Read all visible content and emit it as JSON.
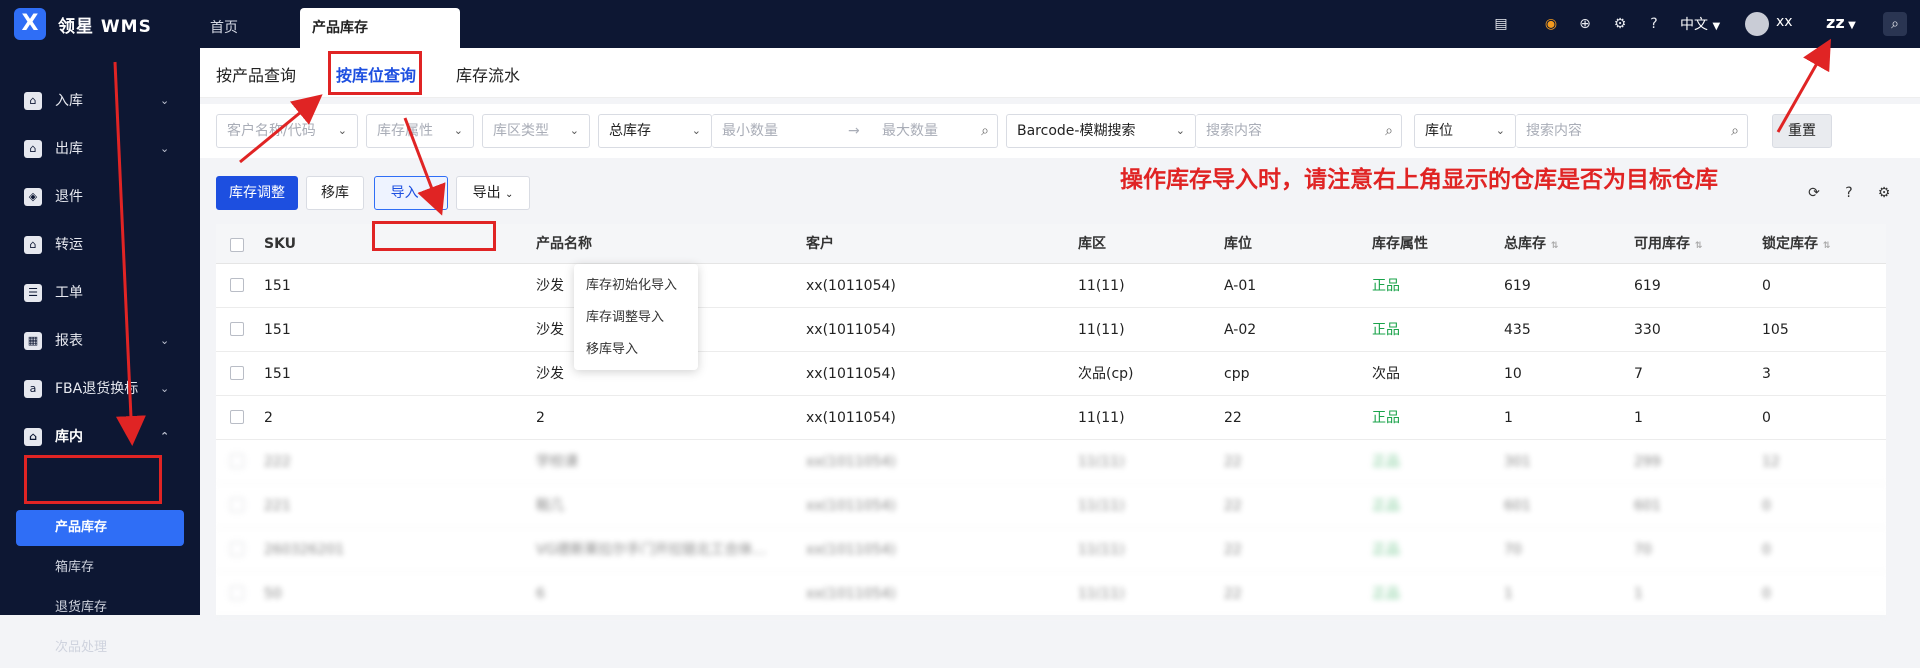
{
  "app": {
    "logo": "X",
    "brand": "领星 WMS"
  },
  "topbar": {
    "tabs": [
      {
        "label": "首页"
      },
      {
        "label": "产品库存"
      }
    ],
    "icons": [
      "printer-icon",
      "robot-icon",
      "download-icon",
      "settings-icon",
      "help-icon"
    ],
    "language": "中文",
    "username": "xx",
    "warehouse": "zz"
  },
  "sidebar": {
    "items": [
      {
        "label": "入库",
        "icon": "inbound-icon",
        "chevron": "⌄"
      },
      {
        "label": "出库",
        "icon": "outbound-icon",
        "chevron": "⌄"
      },
      {
        "label": "退件",
        "icon": "return-icon"
      },
      {
        "label": "转运",
        "icon": "transfer-icon"
      },
      {
        "label": "工单",
        "icon": "workorder-icon"
      },
      {
        "label": "报表",
        "icon": "report-icon",
        "chevron": "⌄"
      },
      {
        "label": "FBA退货换标",
        "icon": "fba-icon",
        "chevron": "⌄"
      },
      {
        "label": "库内",
        "icon": "warehouse-icon",
        "chevron": "⌃"
      }
    ],
    "subitems": [
      {
        "label": "产品库存"
      },
      {
        "label": "箱库存"
      },
      {
        "label": "退货库存"
      },
      {
        "label": "次品处理"
      }
    ]
  },
  "subtabs": [
    {
      "label": "按产品查询"
    },
    {
      "label": "按库位查询"
    },
    {
      "label": "库存流水"
    }
  ],
  "filters": {
    "customer_placeholder": "客户名称/代码",
    "attr_placeholder": "库存属性",
    "zone_placeholder": "库区类型",
    "stock_type": "总库存",
    "min_placeholder": "最小数量",
    "arrow": "→",
    "max_placeholder": "最大数量",
    "barcode_mode": "Barcode-模糊搜索",
    "search1_placeholder": "搜索内容",
    "location_mode": "库位",
    "search2_placeholder": "搜索内容",
    "reset": "重置"
  },
  "actions": {
    "adjust": "库存调整",
    "move": "移库",
    "import": "导入",
    "export": "导出"
  },
  "import_menu": [
    "库存初始化导入",
    "库存调整导入",
    "移库导入"
  ],
  "table": {
    "headers": [
      "SKU",
      "产品名称",
      "客户",
      "库区",
      "库位",
      "库存属性",
      "总库存",
      "可用库存",
      "锁定库存"
    ],
    "rows": [
      {
        "sku": "151",
        "name": "沙发",
        "customer": "xx(1011054)",
        "zone": "11(11)",
        "location": "A-01",
        "attr": "正品",
        "total": "619",
        "available": "619",
        "locked": "0"
      },
      {
        "sku": "151",
        "name": "沙发",
        "customer": "xx(1011054)",
        "zone": "11(11)",
        "location": "A-02",
        "attr": "正品",
        "total": "435",
        "available": "330",
        "locked": "105"
      },
      {
        "sku": "151",
        "name": "沙发",
        "customer": "xx(1011054)",
        "zone": "次品(cp)",
        "location": "cpp",
        "attr": "次品",
        "total": "10",
        "available": "7",
        "locked": "3"
      },
      {
        "sku": "2",
        "name": "2",
        "customer": "xx(1011054)",
        "zone": "11(11)",
        "location": "22",
        "attr": "正品",
        "total": "1",
        "available": "1",
        "locked": "0"
      },
      {
        "sku": "222",
        "name": "学校课",
        "customer": "xx(1011054)",
        "zone": "11(11)",
        "location": "22",
        "attr": "正品",
        "total": "301",
        "available": "299",
        "locked": "12"
      },
      {
        "sku": "221",
        "name": "鞋几",
        "customer": "xx(1011054)",
        "zone": "11(11)",
        "location": "22",
        "attr": "正品",
        "total": "601",
        "available": "601",
        "locked": "0"
      },
      {
        "sku": "260326201",
        "name": "VG德斯莱拉尔手门开拉链北工合体…",
        "customer": "xx(1011054)",
        "zone": "11(11)",
        "location": "22",
        "attr": "正品",
        "total": "70",
        "available": "70",
        "locked": "0"
      },
      {
        "sku": "50",
        "name": "6",
        "customer": "xx(1011054)",
        "zone": "11(11)",
        "location": "22",
        "attr": "正品",
        "total": "1",
        "available": "1",
        "locked": "0"
      }
    ]
  },
  "annotation": {
    "note": "操作库存导入时，请注意右上角显示的仓库是否为目标仓库",
    "color": "#e02424"
  }
}
